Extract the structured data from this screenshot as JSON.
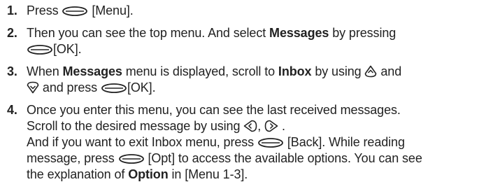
{
  "steps": [
    {
      "number": "1.",
      "t1": "Press",
      "t2": "[Menu]",
      "t3": "."
    },
    {
      "number": "2.",
      "t1": "Then you can see the top menu. And select",
      "b1": "Messages",
      "t2": "by pressing",
      "t3": "[OK]."
    },
    {
      "number": "3.",
      "t1": "When",
      "b1": "Messages",
      "t2": "menu is displayed, scroll to",
      "b2": "Inbox",
      "t3": "by using",
      "t4": "and",
      "t5": "and press",
      "t6": "[OK]."
    },
    {
      "number": "4.",
      "t1": "Once you enter this menu, you can see the last received messages.",
      "t2": "Scroll to the desired message by using",
      "t3": ",",
      "t4": ".",
      "t5": "And if you want to exit Inbox menu, press",
      "t6": "[Back]. While reading",
      "t7": "message, press",
      "t8": "[Opt] to access the available options. You can see",
      "t9": "the explanation of",
      "b1": "Option",
      "t10": "in [Menu 1-3]."
    }
  ],
  "icons": {
    "left_soft_key": "left-soft-key-icon",
    "up_key": "up-navigation-key-icon",
    "down_key": "down-navigation-key-icon",
    "left_key": "left-navigation-key-icon",
    "right_key": "right-navigation-key-icon",
    "right_soft_key": "right-soft-key-icon"
  }
}
